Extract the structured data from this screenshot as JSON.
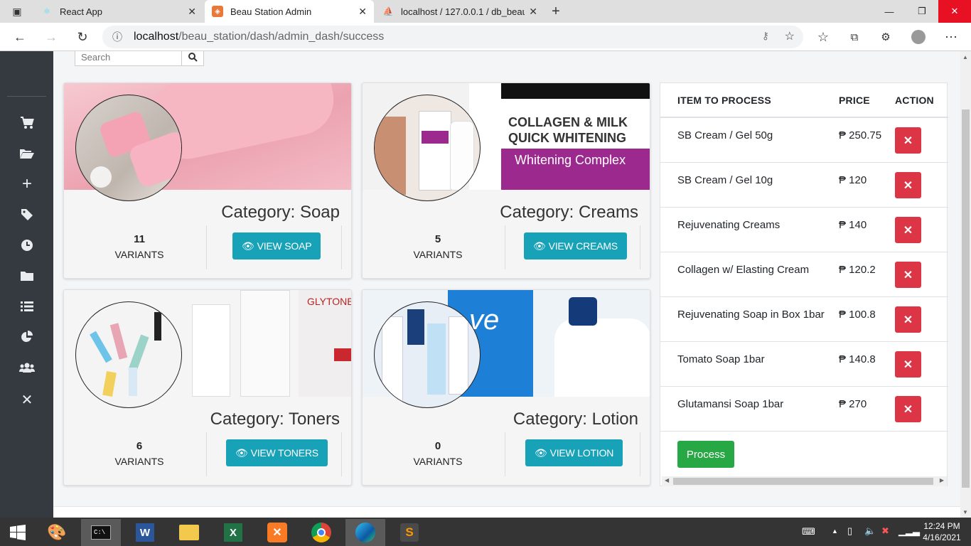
{
  "browser": {
    "tabs": [
      {
        "title": "React App",
        "active": false
      },
      {
        "title": "Beau Station Admin",
        "active": true
      },
      {
        "title": "localhost / 127.0.0.1 / db_beau_...",
        "active": false
      }
    ],
    "url_host": "localhost",
    "url_path": "/beau_station/dash/admin_dash/success"
  },
  "search": {
    "placeholder": "Search"
  },
  "categories": [
    {
      "title": "Category: Soap",
      "count": "11",
      "variants_label": "VARIANTS",
      "button": "VIEW SOAP"
    },
    {
      "title": "Category: Creams",
      "count": "5",
      "variants_label": "VARIANTS",
      "button": "VIEW CREAMS"
    },
    {
      "title": "Category: Toners",
      "count": "6",
      "variants_label": "VARIANTS",
      "button": "VIEW TONERS"
    },
    {
      "title": "Category: Lotion",
      "count": "0",
      "variants_label": "VARIANTS",
      "button": "VIEW LOTION"
    }
  ],
  "process_table": {
    "headers": {
      "item": "ITEM TO PROCESS",
      "price": "PRICE",
      "action": "ACTION"
    },
    "rows": [
      {
        "name": "SB Cream / Gel 50g",
        "price": "₱ 250.75"
      },
      {
        "name": "SB Cream / Gel 10g",
        "price": "₱ 120"
      },
      {
        "name": "Rejuvenating Creams",
        "price": "₱ 140"
      },
      {
        "name": "Collagen w/ Elasting Cream",
        "price": "₱ 120.2"
      },
      {
        "name": "Rejuvenating Soap in Box 1bar",
        "price": "₱ 100.8"
      },
      {
        "name": "Tomato Soap 1bar",
        "price": "₱ 140.8"
      },
      {
        "name": "Glutamansi Soap 1bar",
        "price": "₱ 270"
      }
    ],
    "process_button": "Process"
  },
  "taskbar": {
    "time": "12:24 PM",
    "date": "4/16/2021"
  },
  "colors": {
    "info": "#17a2b8",
    "danger": "#dc3545",
    "success": "#28a745",
    "sidebar": "#343a40"
  }
}
